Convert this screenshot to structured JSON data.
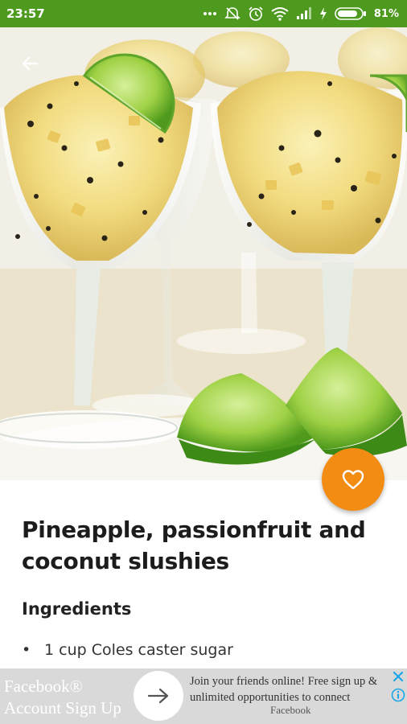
{
  "status_bar": {
    "time": "23:57",
    "battery_percent": "81%",
    "background_color": "#4d9a1e",
    "icons": [
      "more-dots-icon",
      "alarm-off-icon",
      "alarm-icon",
      "wifi-icon",
      "signal-icon",
      "charging-bolt-icon",
      "battery-icon"
    ]
  },
  "navigation": {
    "back_icon": "back-arrow-icon"
  },
  "hero": {
    "subject": "slushies in coupe glasses with lime wedges"
  },
  "favorite": {
    "icon": "heart-outline-icon",
    "color": "#f28c12"
  },
  "recipe": {
    "title": "Pineapple, passionfruit and coconut slushies",
    "ingredients_heading": "Ingredients",
    "ingredients": [
      {
        "bullet": "•",
        "text": "1 cup Coles caster sugar"
      }
    ]
  },
  "ad": {
    "left_text": "Facebook® Account Sign Up",
    "arrow_icon": "arrow-right-icon",
    "body_text": "Join your friends online! Free sign up & unlimited opportunities to connect",
    "sponsor": "Facebook",
    "close_icon": "close-icon",
    "info_icon": "info-icon",
    "accent_color": "#1aa6e8"
  }
}
